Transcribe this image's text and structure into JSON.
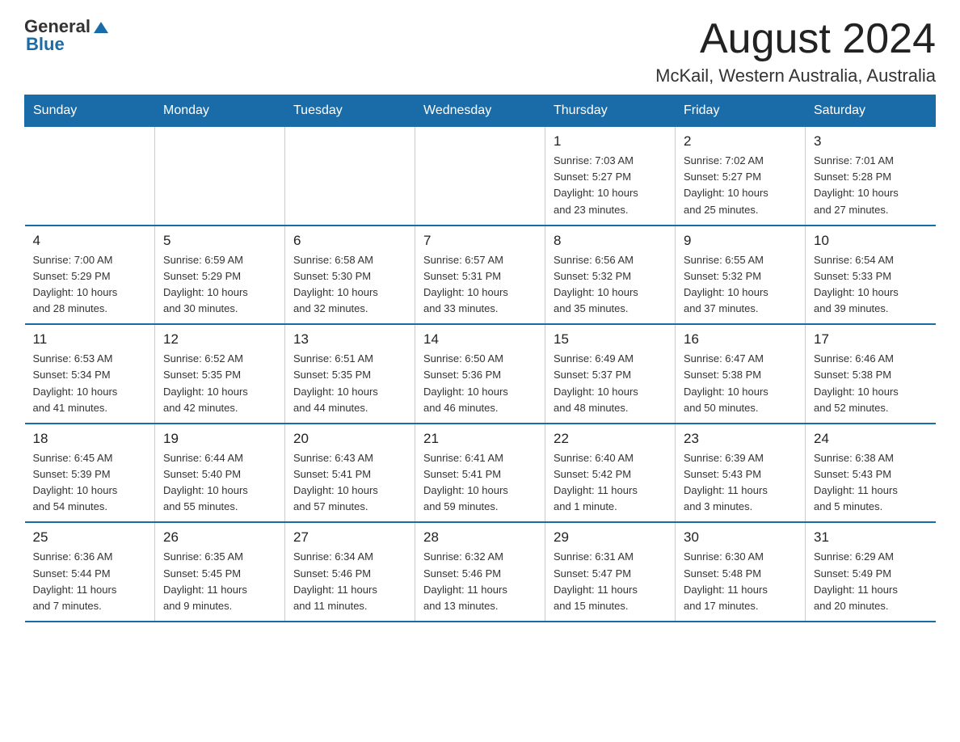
{
  "logo": {
    "general": "General",
    "blue": "Blue"
  },
  "header": {
    "month_year": "August 2024",
    "location": "McKail, Western Australia, Australia"
  },
  "weekdays": [
    "Sunday",
    "Monday",
    "Tuesday",
    "Wednesday",
    "Thursday",
    "Friday",
    "Saturday"
  ],
  "weeks": [
    [
      {
        "day": "",
        "info": ""
      },
      {
        "day": "",
        "info": ""
      },
      {
        "day": "",
        "info": ""
      },
      {
        "day": "",
        "info": ""
      },
      {
        "day": "1",
        "info": "Sunrise: 7:03 AM\nSunset: 5:27 PM\nDaylight: 10 hours\nand 23 minutes."
      },
      {
        "day": "2",
        "info": "Sunrise: 7:02 AM\nSunset: 5:27 PM\nDaylight: 10 hours\nand 25 minutes."
      },
      {
        "day": "3",
        "info": "Sunrise: 7:01 AM\nSunset: 5:28 PM\nDaylight: 10 hours\nand 27 minutes."
      }
    ],
    [
      {
        "day": "4",
        "info": "Sunrise: 7:00 AM\nSunset: 5:29 PM\nDaylight: 10 hours\nand 28 minutes."
      },
      {
        "day": "5",
        "info": "Sunrise: 6:59 AM\nSunset: 5:29 PM\nDaylight: 10 hours\nand 30 minutes."
      },
      {
        "day": "6",
        "info": "Sunrise: 6:58 AM\nSunset: 5:30 PM\nDaylight: 10 hours\nand 32 minutes."
      },
      {
        "day": "7",
        "info": "Sunrise: 6:57 AM\nSunset: 5:31 PM\nDaylight: 10 hours\nand 33 minutes."
      },
      {
        "day": "8",
        "info": "Sunrise: 6:56 AM\nSunset: 5:32 PM\nDaylight: 10 hours\nand 35 minutes."
      },
      {
        "day": "9",
        "info": "Sunrise: 6:55 AM\nSunset: 5:32 PM\nDaylight: 10 hours\nand 37 minutes."
      },
      {
        "day": "10",
        "info": "Sunrise: 6:54 AM\nSunset: 5:33 PM\nDaylight: 10 hours\nand 39 minutes."
      }
    ],
    [
      {
        "day": "11",
        "info": "Sunrise: 6:53 AM\nSunset: 5:34 PM\nDaylight: 10 hours\nand 41 minutes."
      },
      {
        "day": "12",
        "info": "Sunrise: 6:52 AM\nSunset: 5:35 PM\nDaylight: 10 hours\nand 42 minutes."
      },
      {
        "day": "13",
        "info": "Sunrise: 6:51 AM\nSunset: 5:35 PM\nDaylight: 10 hours\nand 44 minutes."
      },
      {
        "day": "14",
        "info": "Sunrise: 6:50 AM\nSunset: 5:36 PM\nDaylight: 10 hours\nand 46 minutes."
      },
      {
        "day": "15",
        "info": "Sunrise: 6:49 AM\nSunset: 5:37 PM\nDaylight: 10 hours\nand 48 minutes."
      },
      {
        "day": "16",
        "info": "Sunrise: 6:47 AM\nSunset: 5:38 PM\nDaylight: 10 hours\nand 50 minutes."
      },
      {
        "day": "17",
        "info": "Sunrise: 6:46 AM\nSunset: 5:38 PM\nDaylight: 10 hours\nand 52 minutes."
      }
    ],
    [
      {
        "day": "18",
        "info": "Sunrise: 6:45 AM\nSunset: 5:39 PM\nDaylight: 10 hours\nand 54 minutes."
      },
      {
        "day": "19",
        "info": "Sunrise: 6:44 AM\nSunset: 5:40 PM\nDaylight: 10 hours\nand 55 minutes."
      },
      {
        "day": "20",
        "info": "Sunrise: 6:43 AM\nSunset: 5:41 PM\nDaylight: 10 hours\nand 57 minutes."
      },
      {
        "day": "21",
        "info": "Sunrise: 6:41 AM\nSunset: 5:41 PM\nDaylight: 10 hours\nand 59 minutes."
      },
      {
        "day": "22",
        "info": "Sunrise: 6:40 AM\nSunset: 5:42 PM\nDaylight: 11 hours\nand 1 minute."
      },
      {
        "day": "23",
        "info": "Sunrise: 6:39 AM\nSunset: 5:43 PM\nDaylight: 11 hours\nand 3 minutes."
      },
      {
        "day": "24",
        "info": "Sunrise: 6:38 AM\nSunset: 5:43 PM\nDaylight: 11 hours\nand 5 minutes."
      }
    ],
    [
      {
        "day": "25",
        "info": "Sunrise: 6:36 AM\nSunset: 5:44 PM\nDaylight: 11 hours\nand 7 minutes."
      },
      {
        "day": "26",
        "info": "Sunrise: 6:35 AM\nSunset: 5:45 PM\nDaylight: 11 hours\nand 9 minutes."
      },
      {
        "day": "27",
        "info": "Sunrise: 6:34 AM\nSunset: 5:46 PM\nDaylight: 11 hours\nand 11 minutes."
      },
      {
        "day": "28",
        "info": "Sunrise: 6:32 AM\nSunset: 5:46 PM\nDaylight: 11 hours\nand 13 minutes."
      },
      {
        "day": "29",
        "info": "Sunrise: 6:31 AM\nSunset: 5:47 PM\nDaylight: 11 hours\nand 15 minutes."
      },
      {
        "day": "30",
        "info": "Sunrise: 6:30 AM\nSunset: 5:48 PM\nDaylight: 11 hours\nand 17 minutes."
      },
      {
        "day": "31",
        "info": "Sunrise: 6:29 AM\nSunset: 5:49 PM\nDaylight: 11 hours\nand 20 minutes."
      }
    ]
  ]
}
